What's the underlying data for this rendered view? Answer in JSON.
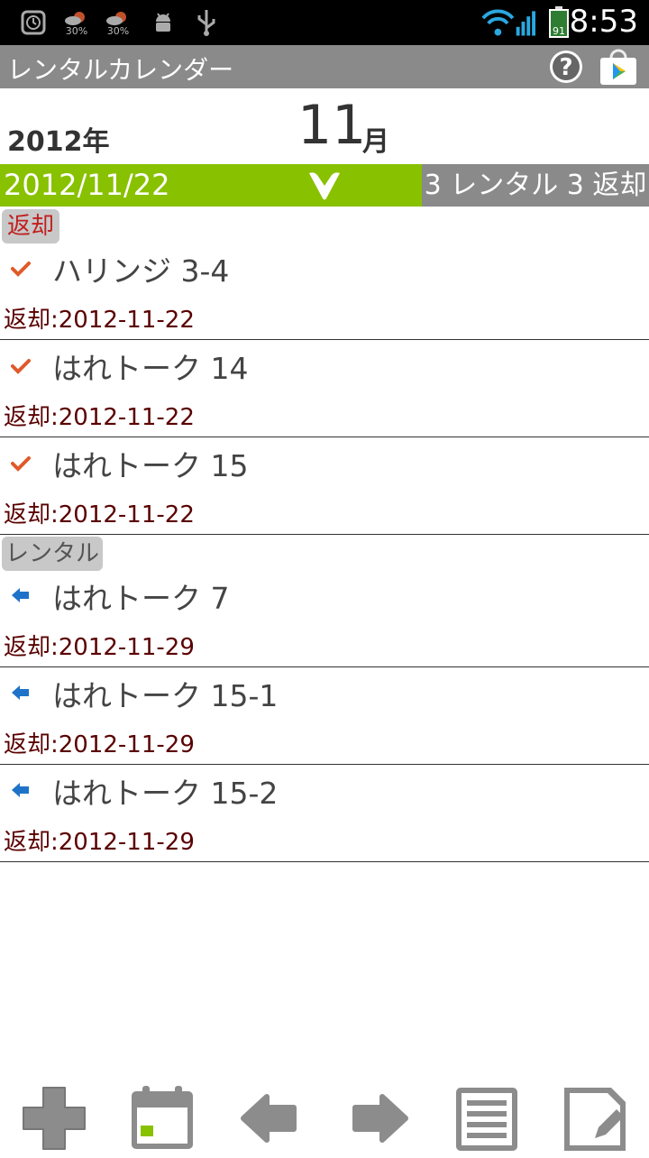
{
  "status_bar": {
    "time": "8:53",
    "weather1": "30%",
    "weather2": "30%",
    "battery": "91"
  },
  "app": {
    "title": "レンタルカレンダー",
    "help_label": "?"
  },
  "header": {
    "year": "2012年",
    "month_number": "11",
    "month_label": "月"
  },
  "date_bar": {
    "date": "2012/11/22",
    "summary": "3 レンタル 3 返却"
  },
  "sections": [
    {
      "label": "返却",
      "label_color": "#c02020",
      "items": [
        {
          "name": "ハリンジ 3-4",
          "due": "返却:2012-11-22"
        },
        {
          "name": "はれトーク 14",
          "due": "返却:2012-11-22"
        },
        {
          "name": "はれトーク 15",
          "due": "返却:2012-11-22"
        }
      ]
    },
    {
      "label": "レンタル",
      "label_color": "#555555",
      "items": [
        {
          "name": "はれトーク 7",
          "due": "返却:2012-11-29"
        },
        {
          "name": "はれトーク 15-1",
          "due": "返却:2012-11-29"
        },
        {
          "name": "はれトーク 15-2",
          "due": "返却:2012-11-29"
        }
      ]
    }
  ],
  "colors": {
    "accent_green": "#88c100",
    "bar_gray": "#8a8a8a",
    "check_orange": "#e05a2a",
    "arrow_blue": "#1e73c8"
  }
}
